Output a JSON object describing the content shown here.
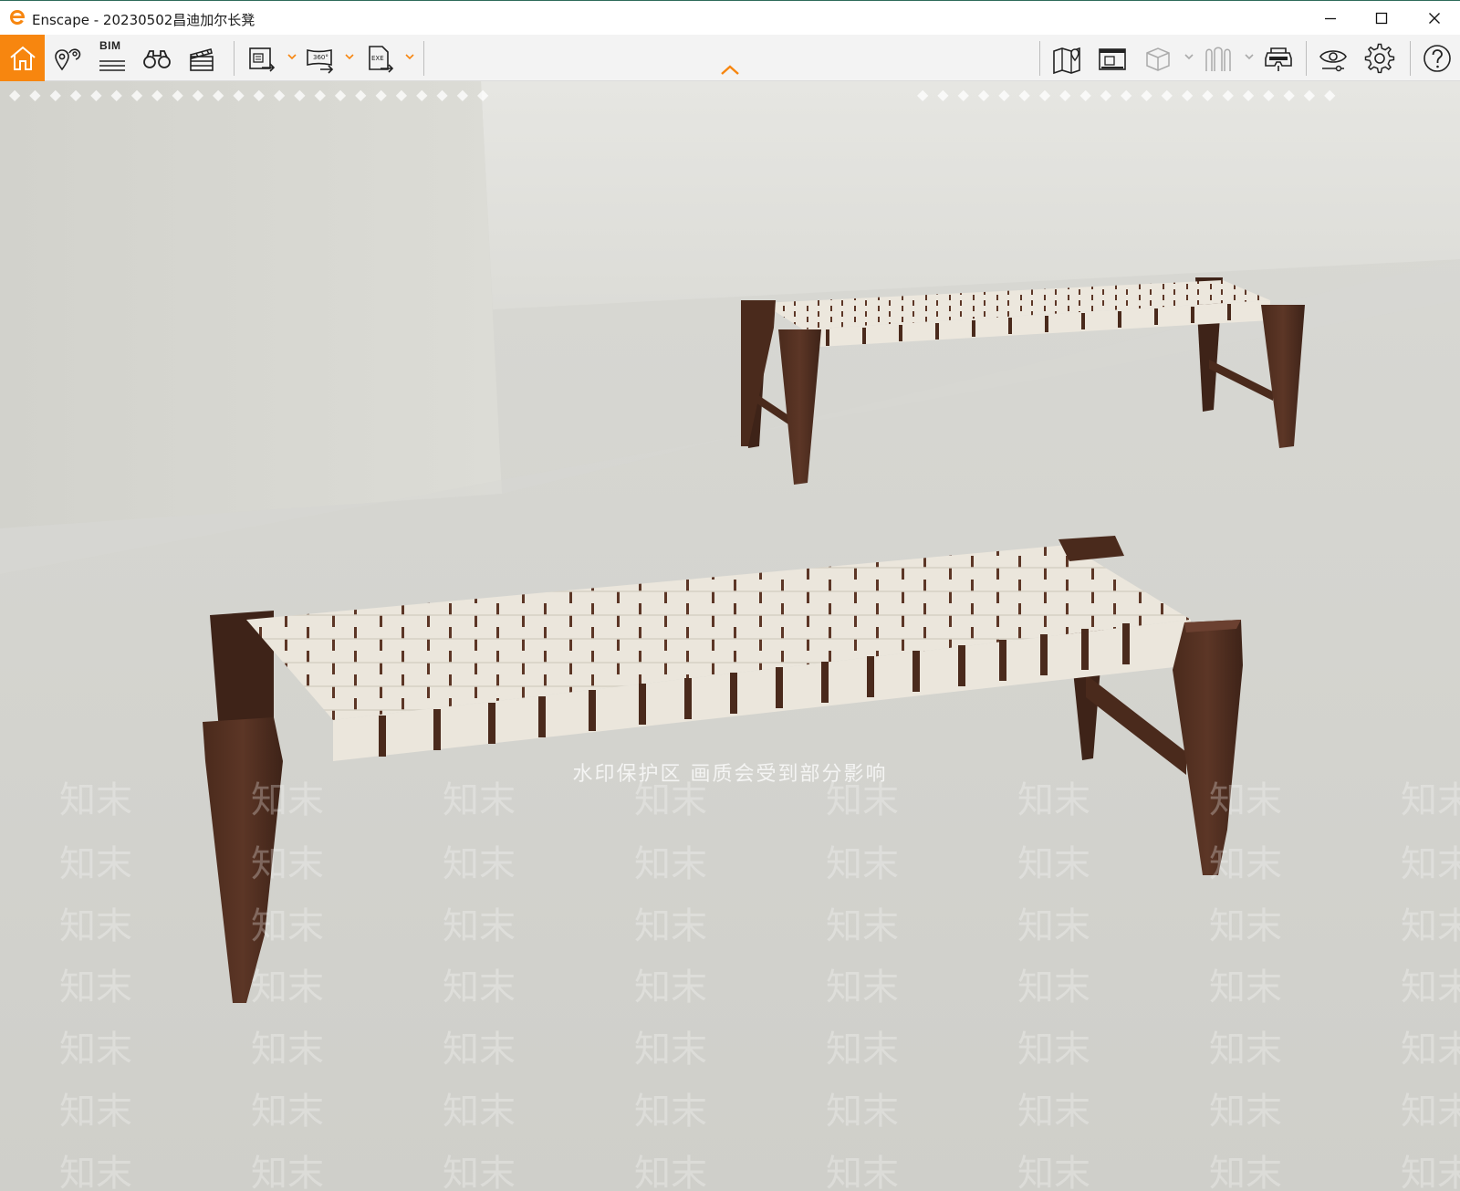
{
  "window": {
    "title": "Enscape - 20230502昌迪加尔长凳",
    "controls": {
      "minimize_icon": "minimize-icon",
      "maximize_icon": "maximize-icon",
      "close_icon": "close-icon"
    }
  },
  "toolbar": {
    "accent_color": "#f7860f",
    "left_tools": [
      {
        "name": "home",
        "icon": "home-icon",
        "active": true
      },
      {
        "name": "views",
        "icon": "location-pin-icon"
      },
      {
        "name": "bim",
        "icon": "bim-icon",
        "label": "BIM"
      },
      {
        "name": "binoculars",
        "icon": "binoculars-icon"
      },
      {
        "name": "video",
        "icon": "clapperboard-icon"
      }
    ],
    "export_tools": [
      {
        "name": "screenshot-export",
        "icon": "image-export-icon"
      },
      {
        "name": "panorama-export",
        "icon": "panorama-export-icon",
        "label": "360°"
      },
      {
        "name": "exe-export",
        "icon": "exe-export-icon",
        "label": "EXE"
      }
    ],
    "right_tools": [
      {
        "name": "map",
        "icon": "map-icon"
      },
      {
        "name": "web-standalone",
        "icon": "web-export-icon"
      },
      {
        "name": "asset-library",
        "icon": "cube-icon",
        "disabled": true
      },
      {
        "name": "material-editor",
        "icon": "material-icon",
        "disabled": true
      },
      {
        "name": "vr-headset",
        "icon": "vr-headset-icon"
      },
      {
        "name": "visual-settings",
        "icon": "eye-icon"
      },
      {
        "name": "settings",
        "icon": "gear-icon"
      },
      {
        "name": "help",
        "icon": "help-icon"
      }
    ]
  },
  "viewport": {
    "watermark_banner": "水印保护区   画质会受到部分影响",
    "watermark_tile": "知末",
    "scene": "render-view"
  }
}
